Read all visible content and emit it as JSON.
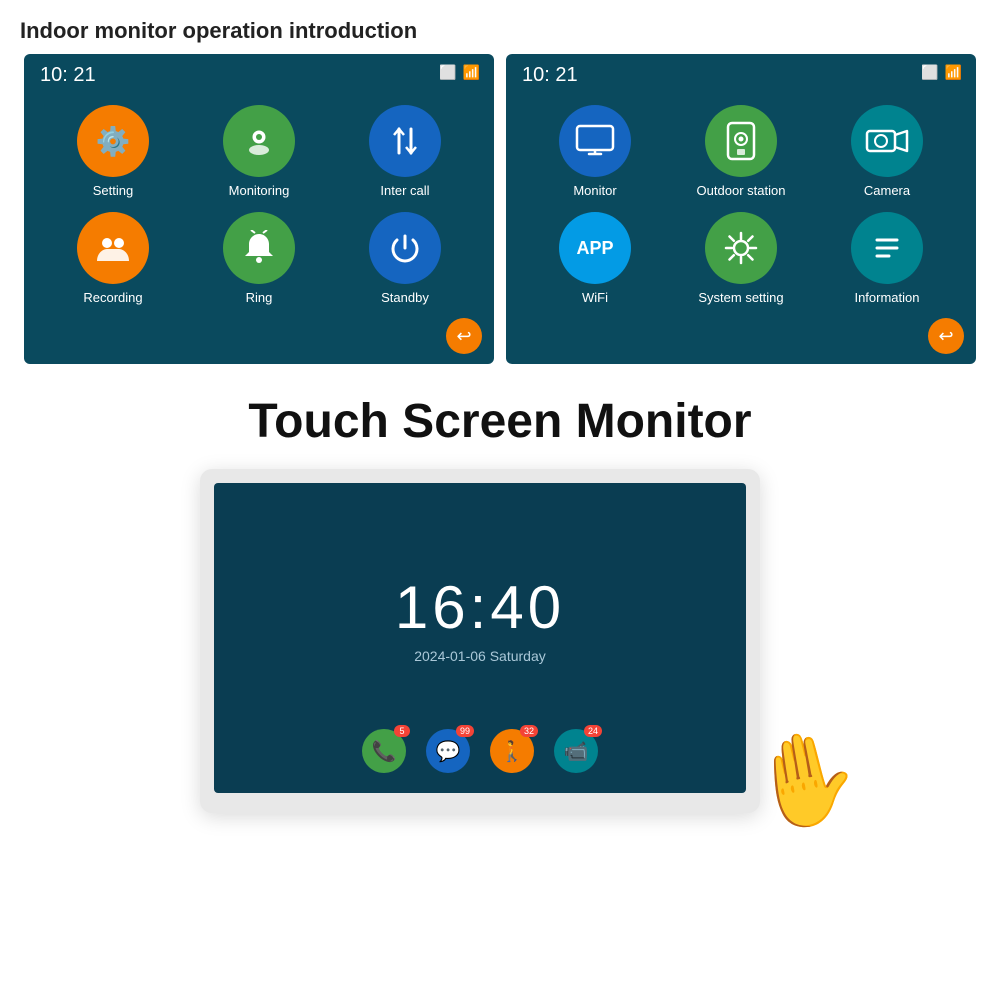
{
  "page": {
    "title": "Indoor monitor operation introduction"
  },
  "screen1": {
    "time": "10: 21",
    "icons": [
      {
        "label": "Setting",
        "color": "orange",
        "emoji": "⚙️"
      },
      {
        "label": "Monitoring",
        "color": "green",
        "emoji": "📷"
      },
      {
        "label": "Inter call",
        "color": "blue-dark",
        "emoji": "⇅"
      },
      {
        "label": "Recording",
        "color": "orange",
        "emoji": "👥"
      },
      {
        "label": "Ring",
        "color": "green",
        "emoji": "🔔"
      },
      {
        "label": "Standby",
        "color": "blue-dark",
        "emoji": "⏻"
      }
    ]
  },
  "screen2": {
    "time": "10: 21",
    "icons": [
      {
        "label": "Monitor",
        "color": "blue-dark",
        "emoji": "🖥"
      },
      {
        "label": "Outdoor station",
        "color": "green",
        "emoji": "📟"
      },
      {
        "label": "Camera",
        "color": "teal",
        "emoji": "📹"
      },
      {
        "label": "WiFi",
        "color": "light-blue",
        "text": "APP"
      },
      {
        "label": "System setting",
        "color": "green",
        "emoji": "⚙️"
      },
      {
        "label": "Information",
        "color": "teal",
        "emoji": "≡"
      }
    ]
  },
  "bottom": {
    "title": "Touch Screen Monitor",
    "clock": "16:40",
    "date": "2024-01-06  Saturday",
    "badges": [
      {
        "emoji": "📞",
        "color": "green",
        "badge": "5"
      },
      {
        "emoji": "💬",
        "color": "blue-dark",
        "badge": "99"
      },
      {
        "emoji": "🚶",
        "color": "orange",
        "badge": "32"
      },
      {
        "emoji": "📹",
        "color": "teal",
        "badge": "24"
      }
    ]
  }
}
